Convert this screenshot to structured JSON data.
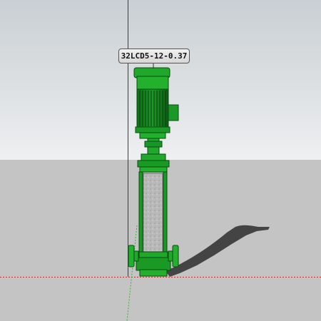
{
  "viewport": {
    "sky_color": "#d9dde0",
    "ground_color": "#c4c4c4",
    "axis_colors": {
      "blue": "#2a2ad0",
      "red": "#c83030",
      "green": "#39b039"
    }
  },
  "model": {
    "name": "32LCD5-12-0.37",
    "body_color": "#1fa82a",
    "cylinder_color": "#b8b8b8"
  }
}
